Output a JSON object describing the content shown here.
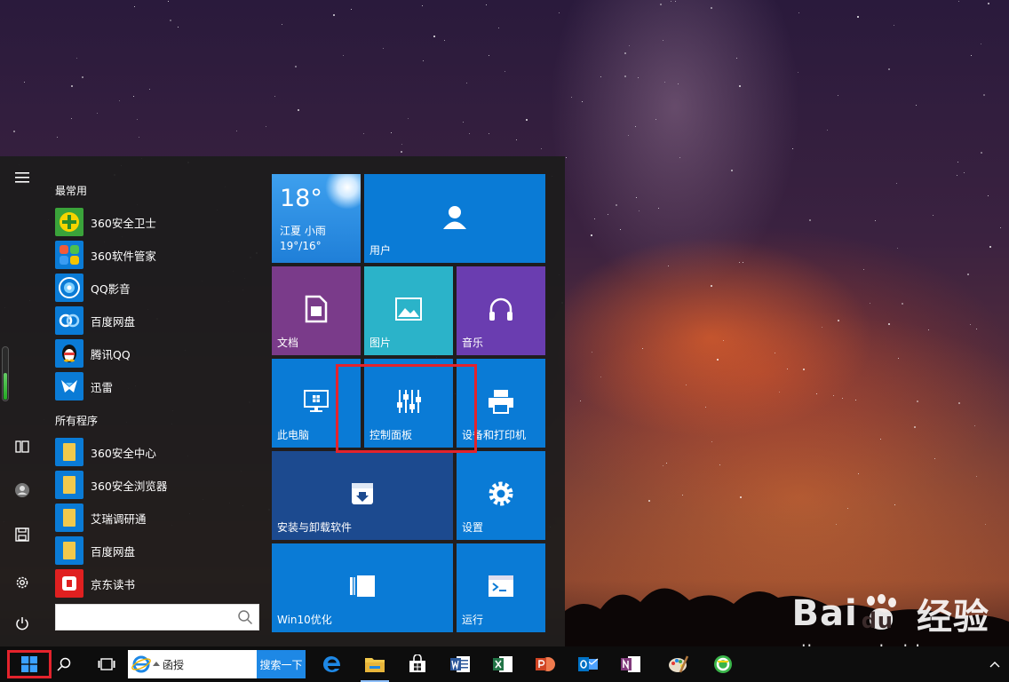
{
  "colors": {
    "tile_blue": "#0a7bd6",
    "tile_purple": "#7a3b8a",
    "tile_teal": "#2bb3c9",
    "tile_violet": "#6a3db0",
    "tile_navy": "#1c4a8f",
    "highlight": "#e3232c"
  },
  "start_menu": {
    "rail": {
      "menu_icon": "hamburger-icon",
      "items": [
        {
          "icon": "tablet-mode-icon"
        },
        {
          "icon": "user-icon"
        },
        {
          "icon": "save-icon"
        },
        {
          "icon": "gear-icon"
        },
        {
          "icon": "power-icon"
        }
      ]
    },
    "groups": {
      "frequent": "最常用",
      "all": "所有程序"
    },
    "frequent_apps": [
      {
        "label": "360安全卫士",
        "icon": "360-guard-icon"
      },
      {
        "label": "360软件管家",
        "icon": "360-software-icon"
      },
      {
        "label": "QQ影音",
        "icon": "qq-player-icon"
      },
      {
        "label": "百度网盘",
        "icon": "baidu-netdisk-icon"
      },
      {
        "label": "腾讯QQ",
        "icon": "qq-penguin-icon"
      },
      {
        "label": "迅雷",
        "icon": "xunlei-icon"
      }
    ],
    "all_apps": [
      {
        "label": "360安全中心",
        "icon": "folder-icon"
      },
      {
        "label": "360安全浏览器",
        "icon": "folder-icon"
      },
      {
        "label": "艾瑞调研通",
        "icon": "folder-icon"
      },
      {
        "label": "百度网盘",
        "icon": "folder-icon"
      },
      {
        "label": "京东读书",
        "icon": "jd-read-icon"
      }
    ],
    "search": {
      "value": "",
      "icon": "search-icon"
    },
    "tiles": {
      "weather": {
        "temp": "18°",
        "place": "江夏 小雨",
        "range": "19°/16°"
      },
      "user": "用户",
      "docs": "文档",
      "pictures": "图片",
      "music": "音乐",
      "pc": "此电脑",
      "control_panel": "控制面板",
      "devices": "设备和打印机",
      "install": "安装与卸载软件",
      "settings": "设置",
      "win10": "Win10优化",
      "run": "运行"
    }
  },
  "taskbar": {
    "search_text": "函授",
    "search_button": "搜索一下",
    "apps": [
      {
        "icon": "edge-icon"
      },
      {
        "icon": "file-explorer-icon"
      },
      {
        "icon": "store-icon"
      },
      {
        "icon": "word-icon"
      },
      {
        "icon": "excel-icon"
      },
      {
        "icon": "powerpoint-icon"
      },
      {
        "icon": "outlook-icon"
      },
      {
        "icon": "onenote-icon"
      },
      {
        "icon": "paint-icon"
      },
      {
        "icon": "360-browser-icon"
      }
    ]
  },
  "watermark": {
    "brand_latin": "Bai",
    "brand_du": "du",
    "brand_cn": "经验",
    "url": "jingyan.baidu.com"
  }
}
